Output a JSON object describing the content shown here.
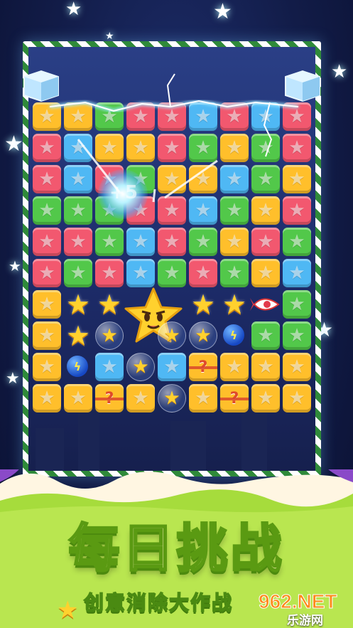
{
  "colors": {
    "red": "#f2586f",
    "blue": "#4fb8f4",
    "yellow": "#ffbf2b",
    "green": "#52c84a",
    "frame_green": "#2f8a3a",
    "title_fill": "#fff6b8",
    "banner_green": "#a6dc3c"
  },
  "board": {
    "rows": [
      [
        "yellow",
        "yellow",
        "green",
        "red",
        "red",
        "blue",
        "red",
        "blue",
        "red"
      ],
      [
        "red",
        "blue",
        "yellow",
        "yellow",
        "red",
        "green",
        "yellow",
        "green",
        "red"
      ],
      [
        "red",
        "blue",
        "red",
        "green",
        "yellow",
        "yellow",
        "blue",
        "green",
        "yellow"
      ],
      [
        "green",
        "green",
        "green",
        "red",
        "red",
        "blue",
        "green",
        "yellow",
        "red"
      ],
      [
        "red",
        "red",
        "green",
        "blue",
        "red",
        "green",
        "yellow",
        "red",
        "green"
      ],
      [
        "red",
        "green",
        "red",
        "blue",
        "green",
        "red",
        "green",
        "yellow",
        "blue"
      ],
      [
        "yellow",
        "star",
        "star",
        "bigstar",
        "bigstar",
        "star",
        "star",
        "rocket",
        "green"
      ],
      [
        "yellow",
        "star",
        "bubble",
        "bigstar",
        "bubble",
        "bubble",
        "bomb",
        "green",
        "green"
      ],
      [
        "yellow",
        "bomb",
        "blue",
        "bubble",
        "blue",
        "mystery",
        "yellow",
        "yellow",
        "yellow"
      ],
      [
        "yellow",
        "yellow",
        "mystery",
        "yellow",
        "bubble",
        "yellow",
        "mystery",
        "yellow",
        "yellow"
      ]
    ],
    "combo_text": "+5"
  },
  "icons": {
    "tile_star": "star-icon",
    "bomb": "lightning-bomb-icon",
    "rocket": "rocket-icon",
    "mystery": "question-mark-box-icon",
    "big_star": "smiling-star-character-icon"
  },
  "banner": {
    "title": "每日挑战",
    "subtitle": "创意消除大作战"
  },
  "watermark": {
    "logo": "962.NET",
    "site": "乐游网"
  }
}
